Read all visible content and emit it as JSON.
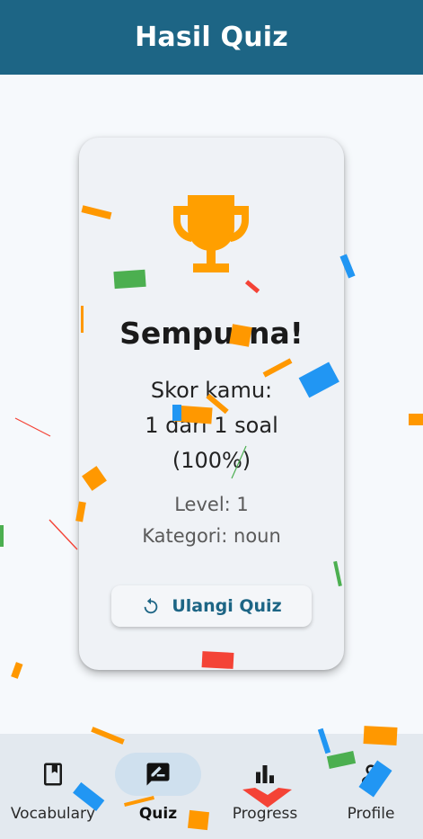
{
  "app_bar": {
    "title": "Hasil Quiz"
  },
  "result": {
    "title": "Sempurna!",
    "score_label": "Skor kamu:",
    "score_line": "1 dari 1 soal",
    "score_percent": "(100%)",
    "level": "Level: 1",
    "category": "Kategori: noun",
    "retry_label": "Ulangi Quiz"
  },
  "bottom_nav": {
    "items": [
      {
        "label": "Vocabulary",
        "icon": "book-icon",
        "active": false
      },
      {
        "label": "Quiz",
        "icon": "quiz-icon",
        "active": true
      },
      {
        "label": "Progress",
        "icon": "bar-chart-icon",
        "active": false
      },
      {
        "label": "Profile",
        "icon": "person-icon",
        "active": false
      }
    ]
  },
  "colors": {
    "app_bar": "#1d6585",
    "trophy": "#ff9f00",
    "accent": "#1d6585",
    "confetti": [
      "#ff9800",
      "#2196f3",
      "#4caf50",
      "#f44336"
    ]
  }
}
